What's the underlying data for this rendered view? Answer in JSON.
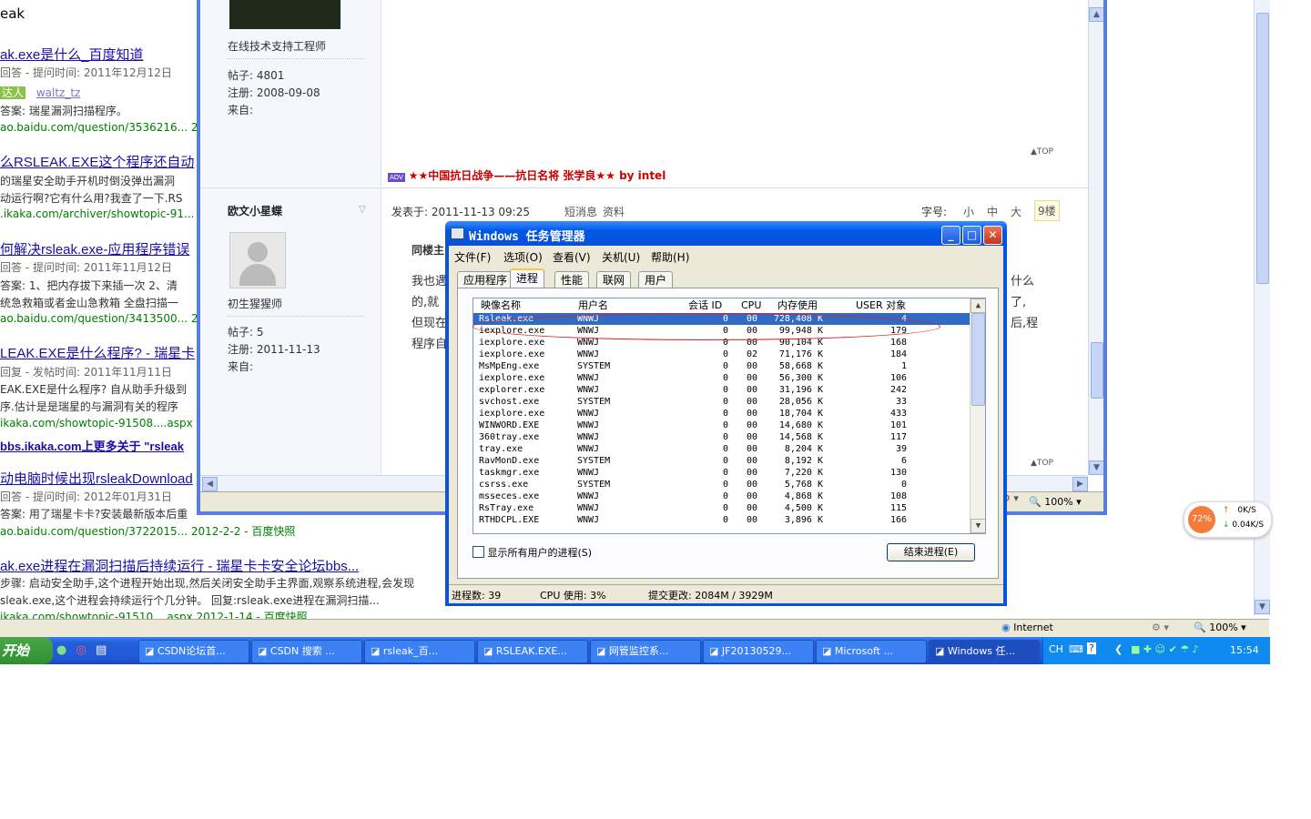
{
  "background_page": {
    "query_fragment": "eak",
    "results": [
      {
        "title": "ak.exe是什么_百度知道",
        "meta": "回答 - 提问时间: 2011年12月12日",
        "badge": "达人",
        "user": "waltz_tz",
        "snippet": "答案: 瑞星漏洞扫描程序。",
        "url": "ao.baidu.com/question/3536216... 20"
      },
      {
        "title": "么RSLEAK.EXE这个程序还自动",
        "snippet1": "的瑞星安全助手开机时倒没弹出漏洞",
        "snippet2": "动运行啊?它有什么用?我查了一下.RS",
        "url": ".ikaka.com/archiver/showtopic-91..."
      },
      {
        "title": "何解决rsleak.exe-应用程序错误",
        "meta": "回答 - 提问时间: 2011年11月12日",
        "snippet": "答案: 1、把内存拔下来插一次  2、清",
        "snippet2": "统急救箱或者金山急救箱  全盘扫描一",
        "url": "ao.baidu.com/question/3413500... 20"
      },
      {
        "title": "LEAK.EXE是什么程序? - 瑞星卡",
        "meta": "回复 - 发帖时间: 2011年11月11日",
        "snippet": "EAK.EXE是什么程序? 自从助手升级到",
        "snippet2": "序.估计是是瑞星的与漏洞有关的程序",
        "url": "ikaka.com/showtopic-91508....aspx 2"
      },
      {
        "title": "bbs.ikaka.com上更多关于 \"rsleak"
      },
      {
        "title": "动电脑时候出现rsleakDownload",
        "meta": "回答 - 提问时间: 2012年01月31日",
        "snippet": "答案: 用了瑞星卡卡?安装最新版本后重",
        "url": "ao.baidu.com/question/3722015... 2012-2-2 - 百度快照"
      },
      {
        "title": "ak.exe进程在漏洞扫描后持续运行 - 瑞星卡卡安全论坛bbs...",
        "snippet": "步骤: 启动安全助手,这个进程开始出现,然后关闭安全助手主界面,观察系统进程,会发现",
        "snippet2": "sleak.exe,这个进程会持续运行个几分钟。 回复:rsleak.exe进程在漏洞扫描...",
        "url": "ikaka.com/showtopic-91510....aspx 2012-1-14 - 百度快照"
      }
    ],
    "status_zone": "Internet",
    "zoom": "100%"
  },
  "forum": {
    "post1": {
      "role": "在线技术支持工程师",
      "posts": "帖子: 4801",
      "reg": "注册: 2008-09-08",
      "from": "来自:"
    },
    "top_link": "TOP",
    "adv_badge": "ADV",
    "ad_text": "★★中国抗日战争——抗日名将 张学良★★ by intel",
    "post2": {
      "author": "欧文小星蝶",
      "role": "初生猩猩师",
      "posts": "帖子: 5",
      "reg": "注册: 2011-11-13",
      "from": "来自:",
      "posted_at": "发表于: 2011-11-13 09:25",
      "pm": "短消息",
      "profile": "资料",
      "font_label": "字号:",
      "font_small": "小",
      "font_mid": "中",
      "font_big": "大",
      "floor": "9楼",
      "quote_head": "同楼主",
      "body_lines": [
        "我也遇",
        "的,就",
        "但现在",
        "程序自动"
      ],
      "body_right": [
        "什么",
        "了,",
        "后,程"
      ]
    },
    "zoom": "100%"
  },
  "taskmgr": {
    "title": "Windows 任务管理器",
    "menu": [
      "文件(F)",
      "选项(O)",
      "查看(V)",
      "关机(U)",
      "帮助(H)"
    ],
    "tabs": [
      "应用程序",
      "进程",
      "性能",
      "联网",
      "用户"
    ],
    "columns": {
      "name": "映像名称",
      "user": "用户名",
      "session": "会话 ID",
      "cpu": "CPU",
      "mem": "内存使用",
      "objects": "USER 对象"
    },
    "processes": [
      {
        "name": "Rsleak.exe",
        "user": "WNWJ",
        "session": "0",
        "cpu": "00",
        "mem": "728,408 K",
        "objects": "4"
      },
      {
        "name": "iexplore.exe",
        "user": "WNWJ",
        "session": "0",
        "cpu": "00",
        "mem": "99,948 K",
        "objects": "179"
      },
      {
        "name": "iexplore.exe",
        "user": "WNWJ",
        "session": "0",
        "cpu": "00",
        "mem": "90,104 K",
        "objects": "168"
      },
      {
        "name": "iexplore.exe",
        "user": "WNWJ",
        "session": "0",
        "cpu": "02",
        "mem": "71,176 K",
        "objects": "184"
      },
      {
        "name": "MsMpEng.exe",
        "user": "SYSTEM",
        "session": "0",
        "cpu": "00",
        "mem": "58,668 K",
        "objects": "1"
      },
      {
        "name": "iexplore.exe",
        "user": "WNWJ",
        "session": "0",
        "cpu": "00",
        "mem": "56,300 K",
        "objects": "106"
      },
      {
        "name": "explorer.exe",
        "user": "WNWJ",
        "session": "0",
        "cpu": "00",
        "mem": "31,196 K",
        "objects": "242"
      },
      {
        "name": "svchost.exe",
        "user": "SYSTEM",
        "session": "0",
        "cpu": "00",
        "mem": "28,056 K",
        "objects": "33"
      },
      {
        "name": "iexplore.exe",
        "user": "WNWJ",
        "session": "0",
        "cpu": "00",
        "mem": "18,704 K",
        "objects": "433"
      },
      {
        "name": "WINWORD.EXE",
        "user": "WNWJ",
        "session": "0",
        "cpu": "00",
        "mem": "14,680 K",
        "objects": "101"
      },
      {
        "name": "360tray.exe",
        "user": "WNWJ",
        "session": "0",
        "cpu": "00",
        "mem": "14,568 K",
        "objects": "117"
      },
      {
        "name": "tray.exe",
        "user": "WNWJ",
        "session": "0",
        "cpu": "00",
        "mem": "8,204 K",
        "objects": "39"
      },
      {
        "name": "RavMonD.exe",
        "user": "SYSTEM",
        "session": "0",
        "cpu": "00",
        "mem": "8,192 K",
        "objects": "6"
      },
      {
        "name": "taskmgr.exe",
        "user": "WNWJ",
        "session": "0",
        "cpu": "00",
        "mem": "7,220 K",
        "objects": "130"
      },
      {
        "name": "csrss.exe",
        "user": "SYSTEM",
        "session": "0",
        "cpu": "00",
        "mem": "5,768 K",
        "objects": "0"
      },
      {
        "name": "msseces.exe",
        "user": "WNWJ",
        "session": "0",
        "cpu": "00",
        "mem": "4,868 K",
        "objects": "108"
      },
      {
        "name": "RsTray.exe",
        "user": "WNWJ",
        "session": "0",
        "cpu": "00",
        "mem": "4,500 K",
        "objects": "115"
      },
      {
        "name": "RTHDCPL.EXE",
        "user": "WNWJ",
        "session": "0",
        "cpu": "00",
        "mem": "3,896 K",
        "objects": "166"
      }
    ],
    "show_all_users": "显示所有用户的进程(S)",
    "end_process": "结束进程(E)",
    "status": {
      "procs": "进程数: 39",
      "cpu": "CPU 使用: 3%",
      "commit": "提交更改: 2084M / 3929M"
    }
  },
  "taskbar": {
    "start": "开始",
    "tasks": [
      "CSDN论坛首...",
      "CSDN 搜索 ...",
      "rsleak_百...",
      "RSLEAK.EXE...",
      "网管监控系...",
      "JF20130529...",
      "Microsoft ...",
      "Windows 任..."
    ],
    "lang": "CH",
    "time": "15:54"
  },
  "speed_widget": {
    "percent": "72%",
    "up": "0K/S",
    "down": "0.04K/S"
  }
}
